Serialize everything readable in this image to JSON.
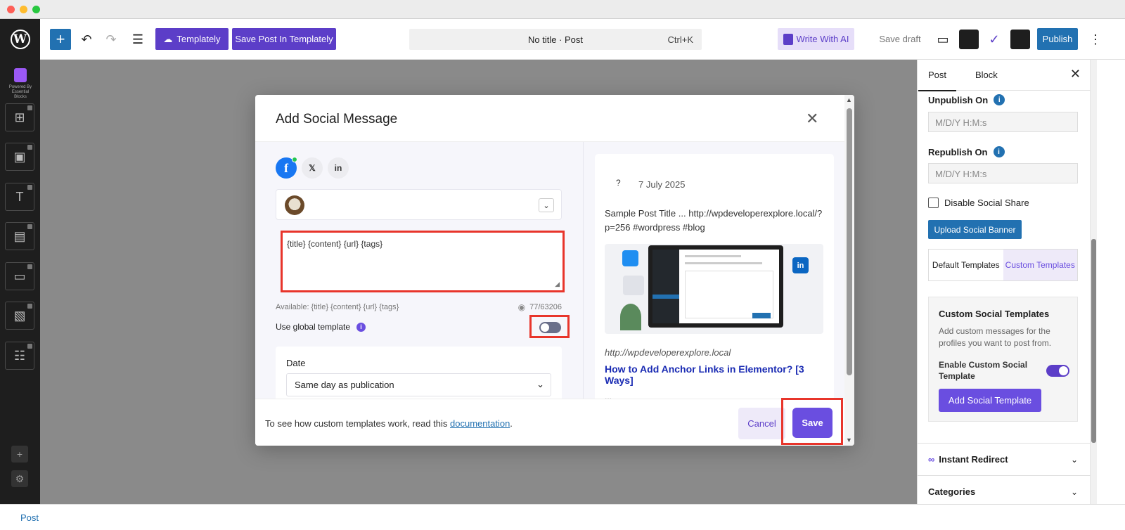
{
  "toolbar": {
    "templately_label": "Templately",
    "save_post_label": "Save Post In Templately",
    "command_title": "No title · Post",
    "command_shortcut": "Ctrl+K",
    "write_ai_label": "Write With AI",
    "save_draft_label": "Save draft",
    "publish_label": "Publish"
  },
  "left_sidebar": {
    "logo_caption": "Powered By Essential Blocks"
  },
  "modal": {
    "title": "Add Social Message",
    "networks": [
      "facebook",
      "x",
      "linkedin"
    ],
    "message_text": "{title} {content} {url} {tags}",
    "available_text": "Available: {title} {content} {url} {tags}",
    "char_count": "77/63206",
    "global_template_label": "Use global template",
    "global_template_enabled": false,
    "date_label": "Date",
    "date_value": "Same day as publication",
    "preview": {
      "question_mark": "?",
      "date": "7 July 2025",
      "text": "Sample Post Title ... http://wpdeveloperexplore.local/?p=256 #wordpress #blog",
      "url": "http://wpdeveloperexplore.local",
      "link_title": "How to Add Anchor Links in Elementor? [3 Ways]",
      "ellipsis": "..."
    },
    "footer_text": "To see how custom templates work, read this ",
    "footer_link": "documentation",
    "footer_period": ".",
    "cancel_label": "Cancel",
    "save_label": "Save"
  },
  "right_panel": {
    "tab_post": "Post",
    "tab_block": "Block",
    "unpublish_label": "Unpublish On",
    "unpublish_placeholder": "M/D/Y H:M:s",
    "republish_label": "Republish On",
    "republish_placeholder": "M/D/Y H:M:s",
    "disable_share_label": "Disable Social Share",
    "upload_banner_label": "Upload Social Banner",
    "default_templates_label": "Default Templates",
    "custom_templates_label": "Custom Templates",
    "custom_box_title": "Custom Social Templates",
    "custom_box_desc": "Add custom messages for the profiles you want to post from.",
    "enable_custom_label": "Enable Custom Social Template",
    "enable_custom_on": true,
    "add_template_label": "Add Social Template",
    "instant_redirect_label": "Instant Redirect",
    "categories_label": "Categories"
  },
  "statusbar": {
    "label": "Post"
  },
  "colors": {
    "accent_purple": "#6a4ee0",
    "wp_blue": "#2271b1",
    "highlight_red": "#e8352b"
  }
}
